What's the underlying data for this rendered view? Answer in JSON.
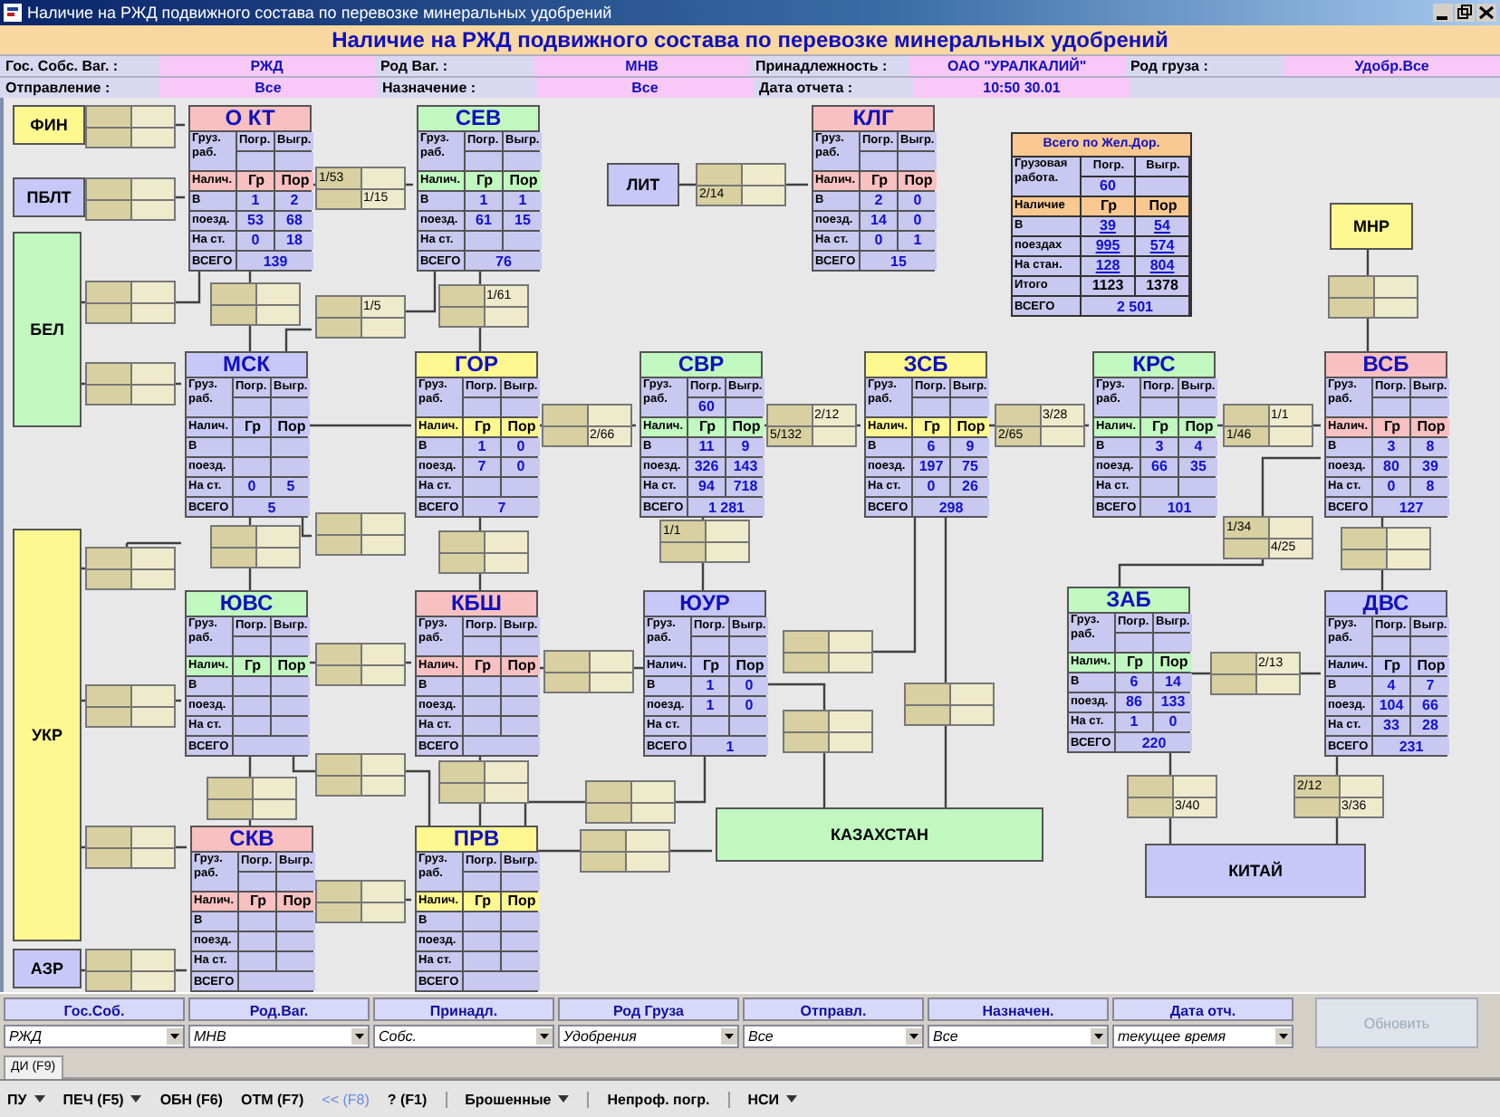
{
  "window": {
    "title": "Наличие на РЖД подвижного состава по перевозке минеральных удобрений"
  },
  "header": {
    "title": "Наличие на РЖД подвижного состава по перевозке минеральных удобрений",
    "rows": [
      [
        {
          "label": "Гос. Собс. Ваг. :",
          "value": "РЖД"
        },
        {
          "label": "Род Ваг. :",
          "value": "МНВ"
        },
        {
          "label": "Принадлежность :",
          "value": "ОАО \"УРАЛКАЛИЙ\""
        },
        {
          "label": "Род груза :",
          "value": "Удобр.Все"
        }
      ],
      [
        {
          "label": "Отправление :",
          "value": "Все"
        },
        {
          "label": "Назначение :",
          "value": "Все"
        },
        {
          "label": "Дата отчета :",
          "value": "10:50 30.01"
        }
      ]
    ]
  },
  "regions": [
    {
      "name": "ФИН",
      "color": "#fff890"
    },
    {
      "name": "ПБЛТ",
      "color": "#c8c8f8"
    },
    {
      "name": "БЕЛ",
      "color": "#c0f8c0"
    },
    {
      "name": "ЛИТ",
      "color": "#c8c8f8"
    },
    {
      "name": "МНР",
      "color": "#fff890"
    },
    {
      "name": "УКР",
      "color": "#fff890"
    },
    {
      "name": "КАЗАХСТАН",
      "color": "#c0f8c0"
    },
    {
      "name": "КИТАЙ",
      "color": "#c8c8f8"
    },
    {
      "name": "АЗР",
      "color": "#c8c8f8"
    }
  ],
  "roads": [
    {
      "name": "О КТ",
      "color": "#f8c0c0",
      "cargo_label": "Груз. раб.",
      "loading_label": "Погр.",
      "unloading_label": "Выгр.",
      "stock_label": "Налич.",
      "gr_label": "Гр",
      "por_label": "Пор",
      "rows": [
        {
          "label": "В",
          "gr": "1",
          "por": "2"
        },
        {
          "label": "поезд.",
          "gr": "53",
          "por": "68"
        },
        {
          "label": "На ст.",
          "gr": "0",
          "por": "18"
        }
      ],
      "total_label": "ВСЕГО",
      "total": "139"
    },
    {
      "name": "СЕВ",
      "color": "#c0f8c0",
      "cargo_label": "Груз. раб.",
      "loading_label": "Погр.",
      "unloading_label": "Выгр.",
      "stock_label": "Налич.",
      "gr_label": "Гр",
      "por_label": "Пор",
      "rows": [
        {
          "label": "В",
          "gr": "1",
          "por": "1"
        },
        {
          "label": "поезд.",
          "gr": "61",
          "por": "15"
        },
        {
          "label": "На ст."
        }
      ],
      "total_label": "ВСЕГО",
      "total": "76"
    },
    {
      "name": "КЛГ",
      "color": "#f8c0c0",
      "cargo_label": "Груз. раб.",
      "loading_label": "Погр.",
      "unloading_label": "Выгр.",
      "stock_label": "Налич.",
      "gr_label": "Гр",
      "por_label": "Пор",
      "rows": [
        {
          "label": "В",
          "gr": "2",
          "por": "0"
        },
        {
          "label": "поезд.",
          "gr": "14",
          "por": "0"
        },
        {
          "label": "На ст.",
          "gr": "0",
          "por": "1"
        }
      ],
      "total_label": "ВСЕГО",
      "total": "15"
    },
    {
      "name": "МСК",
      "color": "#c8c8f8",
      "cargo_label": "Груз. раб.",
      "loading_label": "Погр.",
      "unloading_label": "Выгр.",
      "stock_label": "Налич.",
      "gr_label": "Гр",
      "por_label": "Пор",
      "rows": [
        {
          "label": "В"
        },
        {
          "label": "поезд."
        },
        {
          "label": "На ст.",
          "gr": "0",
          "por": "5"
        }
      ],
      "total_label": "ВСЕГО",
      "total": "5"
    },
    {
      "name": "ГОР",
      "color": "#fff890",
      "cargo_label": "Груз. раб.",
      "loading_label": "Погр.",
      "unloading_label": "Выгр.",
      "stock_label": "Налич.",
      "gr_label": "Гр",
      "por_label": "Пор",
      "rows": [
        {
          "label": "В",
          "gr": "1",
          "por": "0"
        },
        {
          "label": "поезд.",
          "gr": "7",
          "por": "0"
        },
        {
          "label": "На ст."
        }
      ],
      "total_label": "ВСЕГО",
      "total": "7"
    },
    {
      "name": "СВР",
      "color": "#c0f8c0",
      "cargo_label": "Груз. раб.",
      "loading_label": "Погр.",
      "unloading_label": "Выгр.",
      "loading": "60",
      "stock_label": "Налич.",
      "gr_label": "Гр",
      "por_label": "Пор",
      "rows": [
        {
          "label": "В",
          "gr": "11",
          "por": "9"
        },
        {
          "label": "поезд.",
          "gr": "326",
          "por": "143"
        },
        {
          "label": "На ст.",
          "gr": "94",
          "por": "718"
        }
      ],
      "total_label": "ВСЕГО",
      "total": "1 281"
    },
    {
      "name": "ЗСБ",
      "color": "#fff890",
      "cargo_label": "Груз. раб.",
      "loading_label": "Погр.",
      "unloading_label": "Выгр.",
      "stock_label": "Налич.",
      "gr_label": "Гр",
      "por_label": "Пор",
      "rows": [
        {
          "label": "В",
          "gr": "6",
          "por": "9"
        },
        {
          "label": "поезд.",
          "gr": "197",
          "por": "75"
        },
        {
          "label": "На ст.",
          "gr": "0",
          "por": "26"
        }
      ],
      "total_label": "ВСЕГО",
      "total": "298"
    },
    {
      "name": "КРС",
      "color": "#c0f8c0",
      "cargo_label": "Груз. раб.",
      "loading_label": "Погр.",
      "unloading_label": "Выгр.",
      "stock_label": "Налич.",
      "gr_label": "Гр",
      "por_label": "Пор",
      "rows": [
        {
          "label": "В",
          "gr": "3",
          "por": "4"
        },
        {
          "label": "поезд.",
          "gr": "66",
          "por": "35"
        },
        {
          "label": "На ст."
        }
      ],
      "total_label": "ВСЕГО",
      "total": "101"
    },
    {
      "name": "ВСБ",
      "color": "#f8c0c0",
      "cargo_label": "Груз. раб.",
      "loading_label": "Погр.",
      "unloading_label": "Выгр.",
      "stock_label": "Налич.",
      "gr_label": "Гр",
      "por_label": "Пор",
      "rows": [
        {
          "label": "В",
          "gr": "3",
          "por": "8"
        },
        {
          "label": "поезд.",
          "gr": "80",
          "por": "39"
        },
        {
          "label": "На ст.",
          "gr": "0",
          "por": "8"
        }
      ],
      "total_label": "ВСЕГО",
      "total": "127"
    },
    {
      "name": "ЮВС",
      "color": "#c0f8c0",
      "cargo_label": "Груз. раб.",
      "loading_label": "Погр.",
      "unloading_label": "Выгр.",
      "stock_label": "Налич.",
      "gr_label": "Гр",
      "por_label": "Пор",
      "rows": [
        {
          "label": "В"
        },
        {
          "label": "поезд."
        },
        {
          "label": "На ст."
        }
      ],
      "total_label": "ВСЕГО"
    },
    {
      "name": "КБШ",
      "color": "#f8c0c0",
      "cargo_label": "Груз. раб.",
      "loading_label": "Погр.",
      "unloading_label": "Выгр.",
      "stock_label": "Налич.",
      "gr_label": "Гр",
      "por_label": "Пор",
      "rows": [
        {
          "label": "В"
        },
        {
          "label": "поезд."
        },
        {
          "label": "На ст."
        }
      ],
      "total_label": "ВСЕГО"
    },
    {
      "name": "ЮУР",
      "color": "#c8c8f8",
      "cargo_label": "Груз. раб.",
      "loading_label": "Погр.",
      "unloading_label": "Выгр.",
      "stock_label": "Налич.",
      "gr_label": "Гр",
      "por_label": "Пор",
      "rows": [
        {
          "label": "В",
          "gr": "1",
          "por": "0"
        },
        {
          "label": "поезд.",
          "gr": "1",
          "por": "0"
        },
        {
          "label": "На ст."
        }
      ],
      "total_label": "ВСЕГО",
      "total": "1"
    },
    {
      "name": "ЗАБ",
      "color": "#c0f8c0",
      "cargo_label": "Груз. раб.",
      "loading_label": "Погр.",
      "unloading_label": "Выгр.",
      "stock_label": "Налич.",
      "gr_label": "Гр",
      "por_label": "Пор",
      "rows": [
        {
          "label": "В",
          "gr": "6",
          "por": "14"
        },
        {
          "label": "поезд.",
          "gr": "86",
          "por": "133"
        },
        {
          "label": "На ст.",
          "gr": "1",
          "por": "0"
        }
      ],
      "total_label": "ВСЕГО",
      "total": "220"
    },
    {
      "name": "ДВС",
      "color": "#c8c8f8",
      "cargo_label": "Груз. раб.",
      "loading_label": "Погр.",
      "unloading_label": "Выгр.",
      "stock_label": "Налич.",
      "gr_label": "Гр",
      "por_label": "Пор",
      "rows": [
        {
          "label": "В",
          "gr": "4",
          "por": "7"
        },
        {
          "label": "поезд.",
          "gr": "104",
          "por": "66"
        },
        {
          "label": "На ст.",
          "gr": "33",
          "por": "28"
        }
      ],
      "total_label": "ВСЕГО",
      "total": "231"
    },
    {
      "name": "СКВ",
      "color": "#f8c0c0",
      "cargo_label": "Груз. раб.",
      "loading_label": "Погр.",
      "unloading_label": "Выгр.",
      "stock_label": "Налич.",
      "gr_label": "Гр",
      "por_label": "Пор",
      "rows": [
        {
          "label": "В"
        },
        {
          "label": "поезд."
        },
        {
          "label": "На ст."
        }
      ],
      "total_label": "ВСЕГО"
    },
    {
      "name": "ПРВ",
      "color": "#fff890",
      "cargo_label": "Груз. раб.",
      "loading_label": "Погр.",
      "unloading_label": "Выгр.",
      "stock_label": "Налич.",
      "gr_label": "Гр",
      "por_label": "Пор",
      "rows": [
        {
          "label": "В"
        },
        {
          "label": "поезд."
        },
        {
          "label": "На ст."
        }
      ],
      "total_label": "ВСЕГО"
    }
  ],
  "summary": {
    "title": "Всего по Жел.Дор.",
    "cargo_label": "Грузовая работа.",
    "loading_label": "Погр.",
    "unloading_label": "Выгр.",
    "loading": "60",
    "stock_label": "Наличие",
    "gr_label": "Гр",
    "por_label": "Пор",
    "rows": [
      {
        "label": "В",
        "gr": "39",
        "por": "54",
        "kind": "value"
      },
      {
        "label": "поездах",
        "gr": "995",
        "por": "574",
        "kind": "value"
      },
      {
        "label": "На стан.",
        "gr": "128",
        "por": "804",
        "kind": "value"
      },
      {
        "label": "Итого",
        "gr": "1123",
        "por": "1378",
        "kind": "sum"
      }
    ],
    "total_label": "ВСЕГО",
    "total": "2 501"
  },
  "transfers": [
    {
      "top_left": "1/53",
      "bottom_right": "1/15"
    },
    {
      "bottom_left": "2/14"
    },
    {
      "top_right": "1/5"
    },
    {
      "top_right": "1/61"
    },
    {
      "bottom_right": "2/66"
    },
    {
      "top_right": "2/12",
      "bottom_left": "5/132"
    },
    {
      "top_right": "3/28",
      "bottom_left": "2/65"
    },
    {
      "top_right": "1/1",
      "bottom_left": "1/46"
    },
    {
      "top_left": "1/1"
    },
    {
      "top_left": "1/34",
      "bottom_right": "4/25"
    },
    {
      "top_right": "2/13"
    },
    {
      "bottom_right": "3/40"
    },
    {
      "top_left": "2/12",
      "bottom_right": "3/36"
    }
  ],
  "filters": [
    {
      "label": "Гос.Соб.",
      "value": "РЖД"
    },
    {
      "label": "Род.Ваг.",
      "value": "МНВ"
    },
    {
      "label": "Принадл.",
      "value": "Собс."
    },
    {
      "label": "Род Груза",
      "value": "Удобрения"
    },
    {
      "label": "Отправл.",
      "value": "Все"
    },
    {
      "label": "Назначен.",
      "value": "Все"
    },
    {
      "label": "Дата отч.",
      "value": "текущее время"
    }
  ],
  "refresh_button": {
    "label": "Обновить",
    "disabled": true
  },
  "tabs": [
    {
      "label": "ДИ (F9)",
      "selected": true
    }
  ],
  "toolbar": [
    {
      "label": "ПУ",
      "kind": "menu",
      "disabled": false,
      "separated": false
    },
    {
      "label": "ПЕЧ (F5)",
      "kind": "menu",
      "disabled": false,
      "separated": false
    },
    {
      "label": "ОБН (F6)",
      "kind": "button",
      "disabled": false,
      "separated": false
    },
    {
      "label": "ОТМ (F7)",
      "kind": "button",
      "disabled": false,
      "separated": false
    },
    {
      "label": "<< (F8)",
      "kind": "button",
      "disabled": true,
      "separated": false
    },
    {
      "label": "? (F1)",
      "kind": "button",
      "disabled": false,
      "separated": false
    },
    {
      "label": "Брошенные",
      "kind": "menu",
      "disabled": false,
      "separated": true
    },
    {
      "label": "Непроф. погр.",
      "kind": "button",
      "disabled": false,
      "separated": true
    },
    {
      "label": "НСИ",
      "kind": "menu",
      "disabled": false,
      "separated": true
    }
  ]
}
